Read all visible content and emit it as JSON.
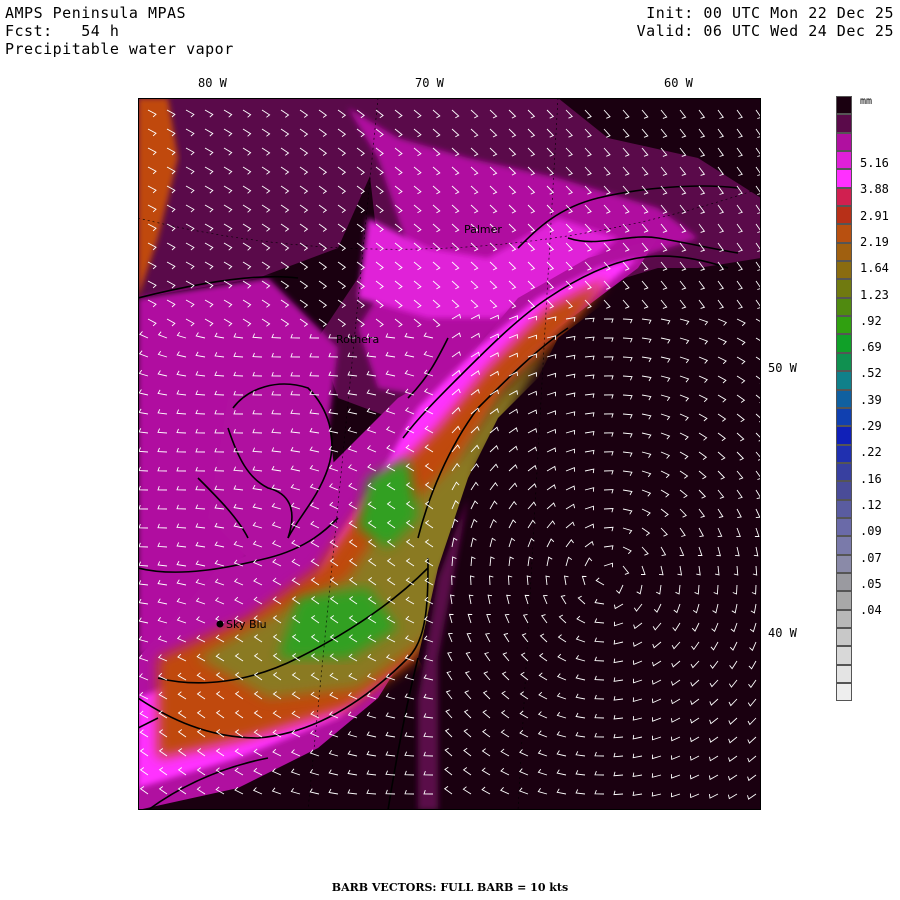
{
  "header": {
    "title": "AMPS Peninsula MPAS",
    "forecast": "Fcst:   54 h",
    "field": "Precipitable water vapor",
    "init": "Init: 00 UTC Mon 22 Dec 25",
    "valid": "Valid: 06 UTC Wed 24 Dec 25"
  },
  "axes": {
    "top_lon_labels": [
      "80 W",
      "70 W",
      "60 W"
    ],
    "right_lon_labels": [
      "50 W",
      "40 W"
    ]
  },
  "map_labels": {
    "stations": [
      "Palmer",
      "Rothera",
      "Sky Blu"
    ]
  },
  "colorbar": {
    "units": "mm",
    "labels": [
      "5.16",
      "3.88",
      "2.91",
      "2.19",
      "1.64",
      "1.23",
      ".92",
      ".69",
      ".52",
      ".39",
      ".29",
      ".22",
      ".16",
      ".12",
      ".09",
      ".07",
      ".05",
      ".04"
    ],
    "colors": [
      "#1a0010",
      "#5a0a4a",
      "#b010a0",
      "#e020d8",
      "#ff30ff",
      "#d02050",
      "#b83018",
      "#b85010",
      "#a06010",
      "#8a6c10",
      "#707a10",
      "#508a10",
      "#30a010",
      "#10a028",
      "#109050",
      "#10808a",
      "#1060a0",
      "#1040b0",
      "#1020b8",
      "#2030b0",
      "#3840a0",
      "#4a4c98",
      "#5a5ca0",
      "#6a6aa8",
      "#7a7aaa",
      "#8a8aa8",
      "#9a9aa0",
      "#a8a8a8",
      "#b8b8b8",
      "#c8c8c8",
      "#d8d8d8",
      "#e4e4e4",
      "#eeeeee"
    ]
  },
  "colors": {
    "dry": "#1a0010",
    "low_moisture": "#5a0a4a",
    "mid_magenta": "#b010a0",
    "bright_magenta": "#ff30ff",
    "orange": "#c04810",
    "olive": "#8a7a20",
    "green": "#30a020"
  },
  "footer": {
    "text": "BARB VECTORS:  FULL BARB = 10 kts"
  }
}
